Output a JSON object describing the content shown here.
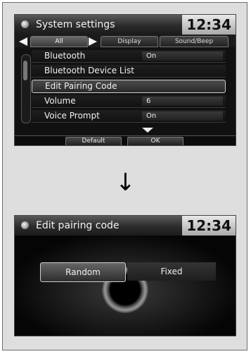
{
  "screen1": {
    "title": "System settings",
    "clock": "12:34",
    "tabs": {
      "all": "All",
      "display": "Display",
      "sound": "Sound/Beep"
    },
    "rows": [
      {
        "label": "Bluetooth",
        "value": "On"
      },
      {
        "label": "Bluetooth Device List",
        "value": ""
      },
      {
        "label": "Edit Pairing Code",
        "value": ""
      },
      {
        "label": "Volume",
        "value": "6"
      },
      {
        "label": "Voice Prompt",
        "value": "On"
      }
    ],
    "buttons": {
      "default": "Default",
      "ok": "OK"
    }
  },
  "between_arrow": "↓",
  "screen2": {
    "title": "Edit pairing code",
    "clock": "12:34",
    "options": {
      "random": "Random",
      "fixed": "Fixed"
    }
  },
  "icons": [
    "settings-icon",
    "left-arrow-icon",
    "right-arrow-icon",
    "down-caret-icon",
    "scrollbar-icon",
    "knob-icon"
  ],
  "colors": {
    "screen_bg": "#111111",
    "frame_bg": "#dedede",
    "clock_bg": "#d0d0d0"
  }
}
